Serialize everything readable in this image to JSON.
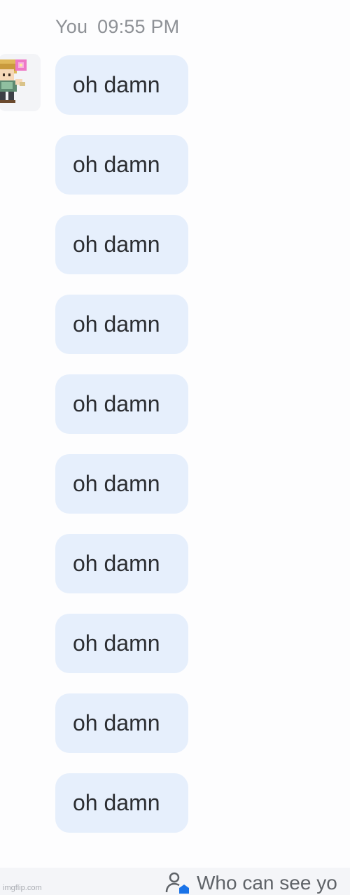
{
  "header": {
    "sender": "You",
    "time": "09:55 PM"
  },
  "avatar": {
    "icon": "pixel-character-avatar"
  },
  "messages": [
    {
      "text": "oh damn"
    },
    {
      "text": "oh damn"
    },
    {
      "text": "oh damn"
    },
    {
      "text": "oh damn"
    },
    {
      "text": "oh damn"
    },
    {
      "text": "oh damn"
    },
    {
      "text": "oh damn"
    },
    {
      "text": "oh damn"
    },
    {
      "text": "oh damn"
    },
    {
      "text": "oh damn"
    }
  ],
  "footer": {
    "visibility_text": "Who can see yo",
    "visibility_icon": "person-visibility-icon",
    "watermark": "imgflip.com"
  },
  "colors": {
    "bubble": "#e6effc",
    "bubble_text": "#2b2d31",
    "header_text": "#8e9196",
    "accent": "#1a73e8",
    "background": "#fdfdfe"
  }
}
